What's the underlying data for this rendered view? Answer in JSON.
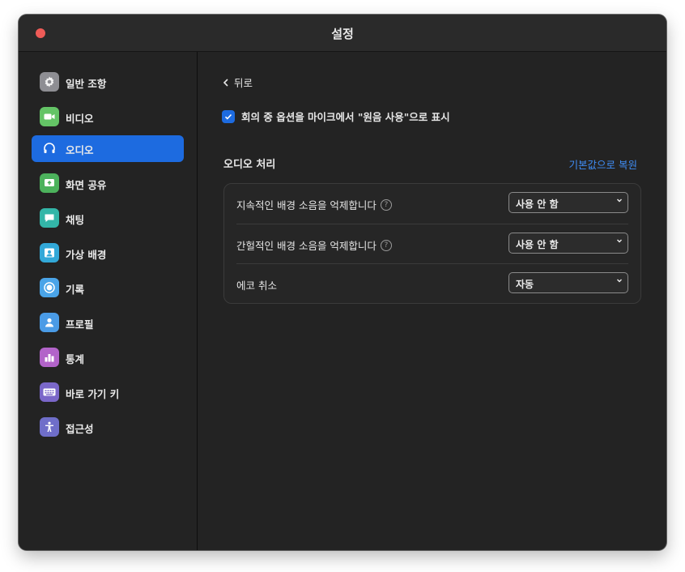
{
  "window": {
    "title": "설정"
  },
  "sidebar": {
    "items": [
      {
        "label": "일반 조항",
        "icon": "gear-icon",
        "color": "#8e8e93",
        "active": false
      },
      {
        "label": "비디오",
        "icon": "video-camera-icon",
        "color": "#64c466",
        "active": false
      },
      {
        "label": "오디오",
        "icon": "headphones-icon",
        "color": "#1d6be0",
        "active": true
      },
      {
        "label": "화면 공유",
        "icon": "screen-share-icon",
        "color": "#4cb25c",
        "active": false
      },
      {
        "label": "채팅",
        "icon": "chat-bubble-icon",
        "color": "#33b6a8",
        "active": false
      },
      {
        "label": "가상 배경",
        "icon": "virtual-background-icon",
        "color": "#32a8d8",
        "active": false
      },
      {
        "label": "기록",
        "icon": "record-icon",
        "color": "#4aa4e8",
        "active": false
      },
      {
        "label": "프로필",
        "icon": "profile-icon",
        "color": "#4a9be6",
        "active": false
      },
      {
        "label": "통계",
        "icon": "statistics-icon",
        "color": "#b263c9",
        "active": false
      },
      {
        "label": "바로 가기 키",
        "icon": "keyboard-icon",
        "color": "#7a67c9",
        "active": false
      },
      {
        "label": "접근성",
        "icon": "accessibility-icon",
        "color": "#6f6ec9",
        "active": false
      }
    ]
  },
  "main": {
    "back_label": "뒤로",
    "checkbox_label": "회의 중 옵션을 마이크에서 \"원음 사용\"으로 표시",
    "checkbox_checked": true,
    "section_title": "오디오 처리",
    "reset_link": "기본값으로 복원",
    "rows": [
      {
        "label": "지속적인 배경 소음을 억제합니다",
        "help": "?",
        "value": "사용 안 함"
      },
      {
        "label": "간헐적인 배경 소음을 억제합니다",
        "help": "?",
        "value": "사용 안 함"
      },
      {
        "label": "에코 취소",
        "help": "",
        "value": "자동"
      }
    ]
  },
  "colors": {
    "accent": "#1d6be0",
    "link": "#3f8df5",
    "close_button": "#ee5b57"
  }
}
